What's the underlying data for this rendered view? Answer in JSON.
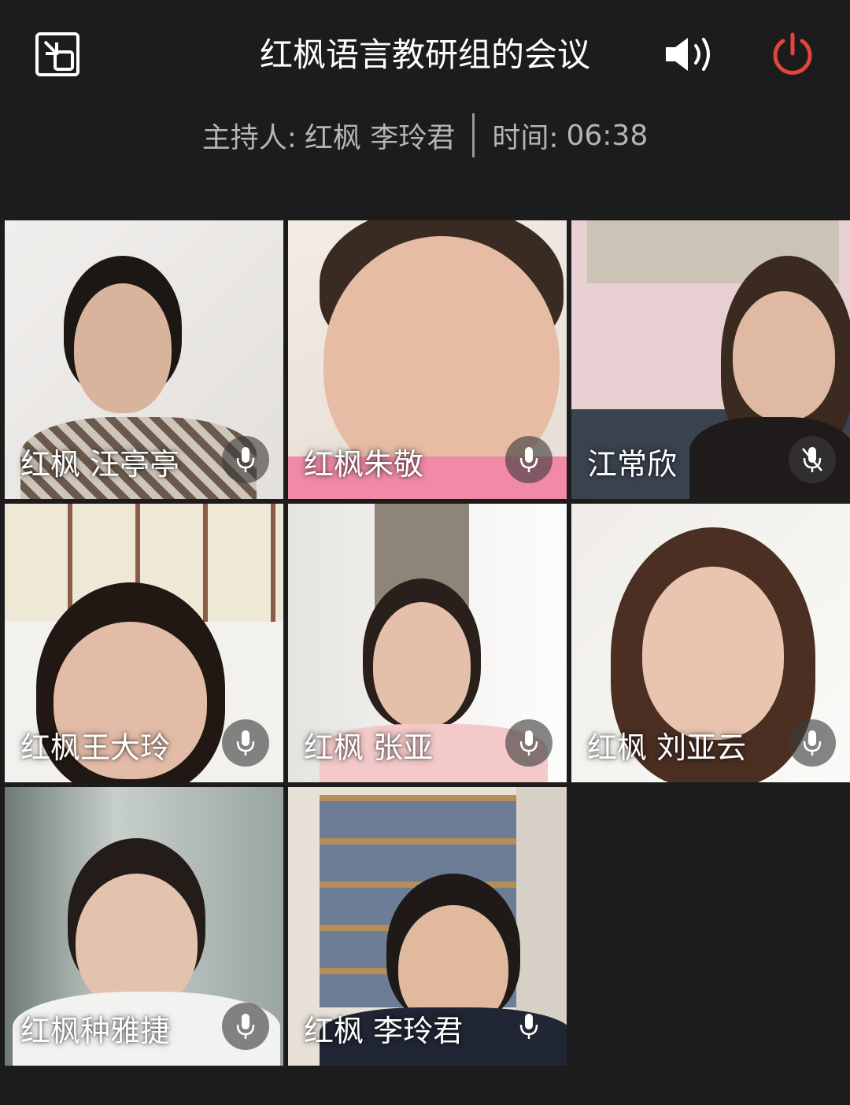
{
  "header": {
    "title": "红枫语言教研组的会议",
    "host_label": "主持人:",
    "host_name": "红枫 李玲君",
    "time_label": "时间:",
    "time_value": "06:38"
  },
  "icons": {
    "shrink": "shrink-window-icon",
    "speaker": "speaker-icon",
    "power": "power-icon",
    "mic": "microphone-icon",
    "mic_muted": "microphone-muted-icon"
  },
  "colors": {
    "background": "#1c1c1c",
    "power_accent": "#e2453b",
    "subtitle_text": "#b5b5b5"
  },
  "participants": [
    {
      "name": "红枫  汪亭亭",
      "mic": "on"
    },
    {
      "name": "红枫朱敬",
      "mic": "on"
    },
    {
      "name": "江常欣",
      "mic": "muted"
    },
    {
      "name": "红枫王大玲",
      "mic": "on"
    },
    {
      "name": "红枫 张亚",
      "mic": "on"
    },
    {
      "name": "红枫  刘亚云",
      "mic": "on"
    },
    {
      "name": "红枫种雅捷",
      "mic": "on"
    },
    {
      "name": "红枫 李玲君",
      "mic": "on"
    }
  ]
}
